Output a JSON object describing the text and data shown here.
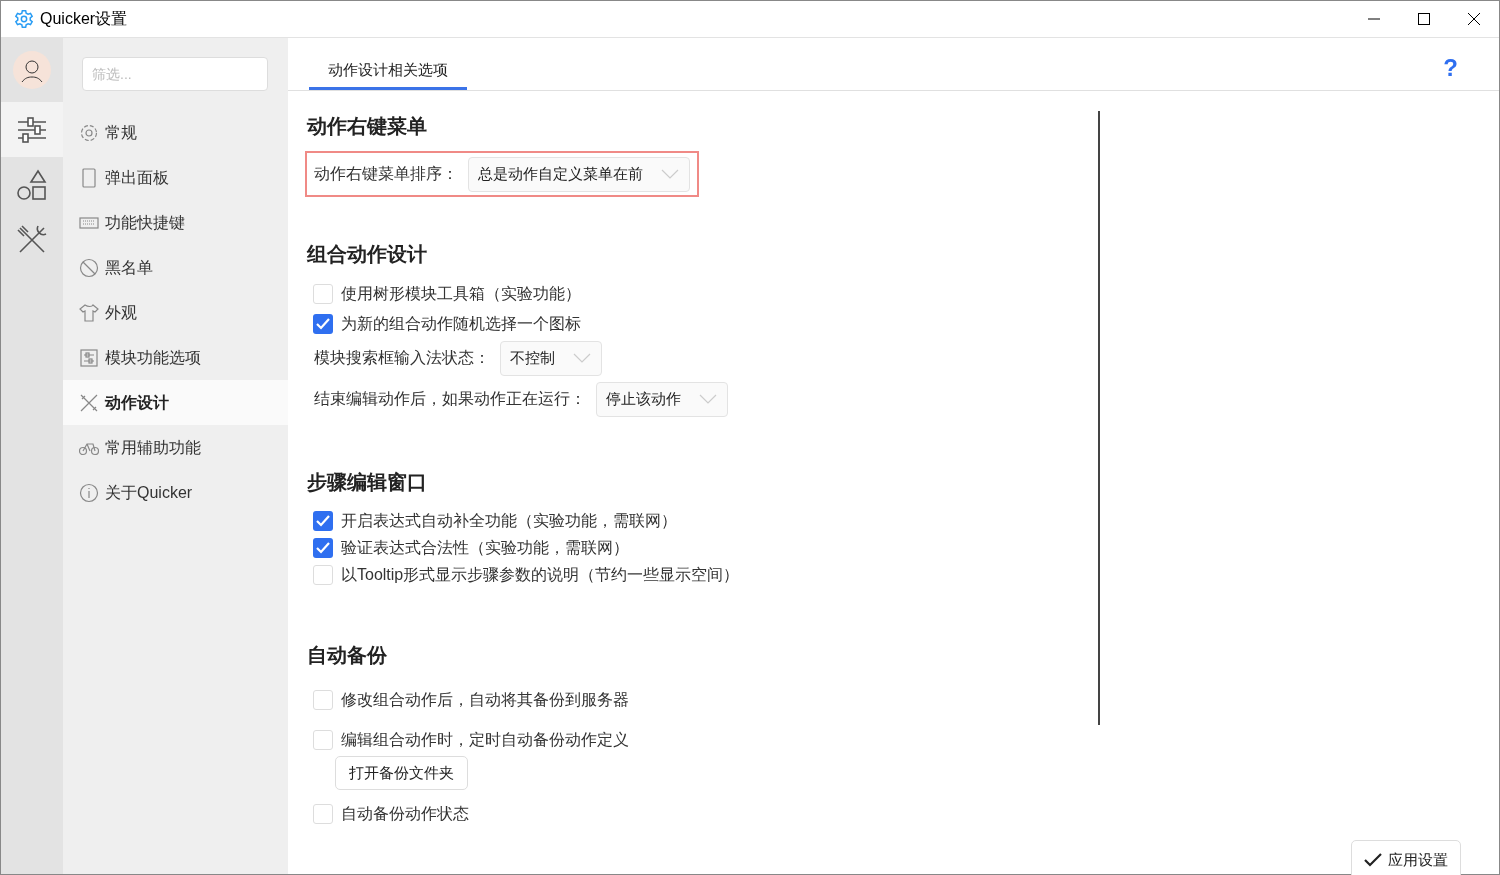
{
  "window": {
    "title": "Quicker设置"
  },
  "rail": [
    {
      "selected": true
    },
    {
      "selected": false
    },
    {
      "selected": false
    }
  ],
  "filter": {
    "placeholder": "筛选..."
  },
  "nav": [
    {
      "label": "常规",
      "selected": false
    },
    {
      "label": "弹出面板",
      "selected": false
    },
    {
      "label": "功能快捷键",
      "selected": false
    },
    {
      "label": "黑名单",
      "selected": false
    },
    {
      "label": "外观",
      "selected": false
    },
    {
      "label": "模块功能选项",
      "selected": false
    },
    {
      "label": "动作设计",
      "selected": true
    },
    {
      "label": "常用辅助功能",
      "selected": false
    },
    {
      "label": "关于Quicker",
      "selected": false
    }
  ],
  "tabs": [
    {
      "label": "动作设计相关选项",
      "selected": true
    }
  ],
  "help": "?",
  "sections": [
    {
      "heading": "动作右键菜单",
      "rows": [
        {
          "kind": "dropdown",
          "label": "动作右键菜单排序：",
          "value": "总是动作自定义菜单在前",
          "highlighted": true
        }
      ]
    },
    {
      "heading": "组合动作设计",
      "rows": [
        {
          "kind": "checkbox",
          "label": "使用树形模块工具箱（实验功能）",
          "checked": false
        },
        {
          "kind": "checkbox",
          "label": "为新的组合动作随机选择一个图标",
          "checked": true
        },
        {
          "kind": "dropdown",
          "label": "模块搜索框输入法状态：",
          "value": "不控制",
          "highlighted": false
        },
        {
          "kind": "dropdown",
          "label": "结束编辑动作后，如果动作正在运行：",
          "value": "停止该动作",
          "highlighted": false
        }
      ]
    },
    {
      "heading": "步骤编辑窗口",
      "rows": [
        {
          "kind": "checkbox",
          "label": "开启表达式自动补全功能（实验功能，需联网）",
          "checked": true
        },
        {
          "kind": "checkbox",
          "label": "验证表达式合法性（实验功能，需联网）",
          "checked": true
        },
        {
          "kind": "checkbox",
          "label": "以Tooltip形式显示步骤参数的说明（节约一些显示空间）",
          "checked": false
        }
      ]
    },
    {
      "heading": "自动备份",
      "rows": [
        {
          "kind": "checkbox",
          "label": "修改组合动作后，自动将其备份到服务器",
          "checked": false
        },
        {
          "kind": "checkbox",
          "label": "编辑组合动作时，定时自动备份动作定义",
          "checked": false
        },
        {
          "kind": "button",
          "label": "打开备份文件夹"
        },
        {
          "kind": "checkbox",
          "label": "自动备份动作状态",
          "checked": false
        }
      ]
    }
  ],
  "apply_button": "应用设置"
}
